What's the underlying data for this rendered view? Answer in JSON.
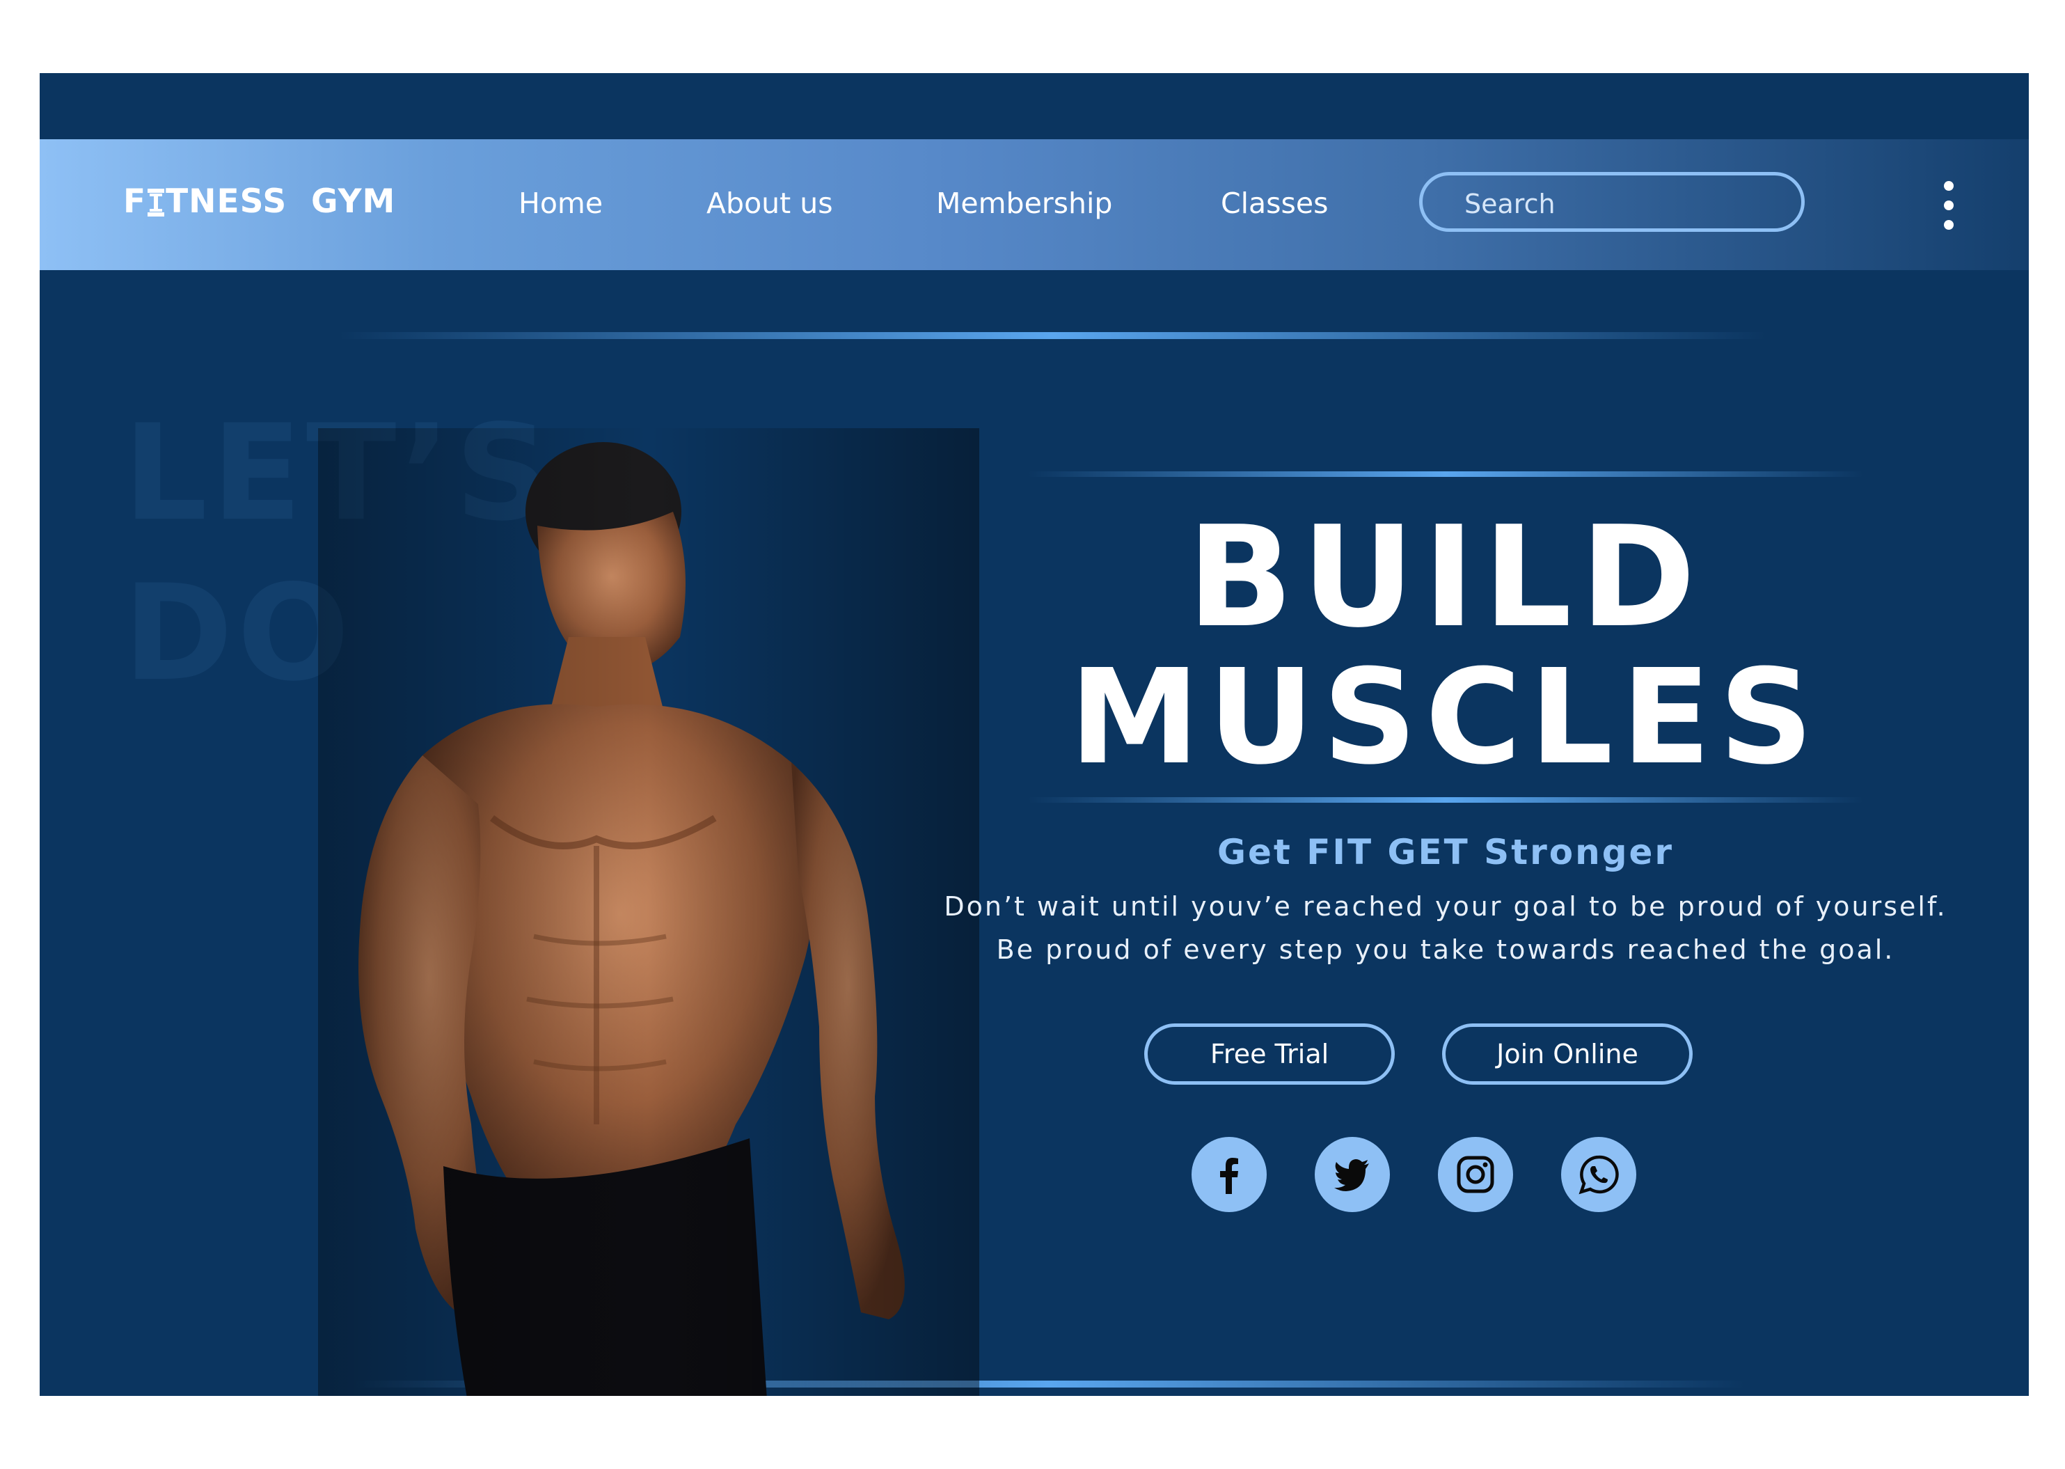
{
  "brand": {
    "logo_prefix": "F",
    "logo_suffix": "TNESS",
    "logo_word2": "GYM"
  },
  "nav": {
    "items": [
      "Home",
      "About us",
      "Membership",
      "Classes"
    ]
  },
  "search": {
    "placeholder": "Search"
  },
  "menu": {
    "icon": "kebab-menu-icon"
  },
  "hero": {
    "background_text": [
      "LET’S",
      "DO"
    ],
    "headline_line1": "BUILD",
    "headline_line2": "MUSCLES",
    "tagline": "Get FIT GET Stronger",
    "description_line1": "Don’t wait until youv’e reached your goal to be proud of yourself.",
    "description_line2": "Be proud of every step you take towards reached the goal.",
    "buttons": {
      "free_trial": "Free Trial",
      "join_online": "Join Online"
    },
    "photo": "shirtless-muscular-man-photo"
  },
  "social": [
    "facebook-icon",
    "twitter-icon",
    "instagram-icon",
    "whatsapp-icon"
  ],
  "colors": {
    "page_bg": "#0b3560",
    "accent": "#8ec0f5",
    "nav_gradient_start": "#8ec0f5",
    "nav_gradient_end": "#143f6d",
    "text": "#ffffff"
  }
}
